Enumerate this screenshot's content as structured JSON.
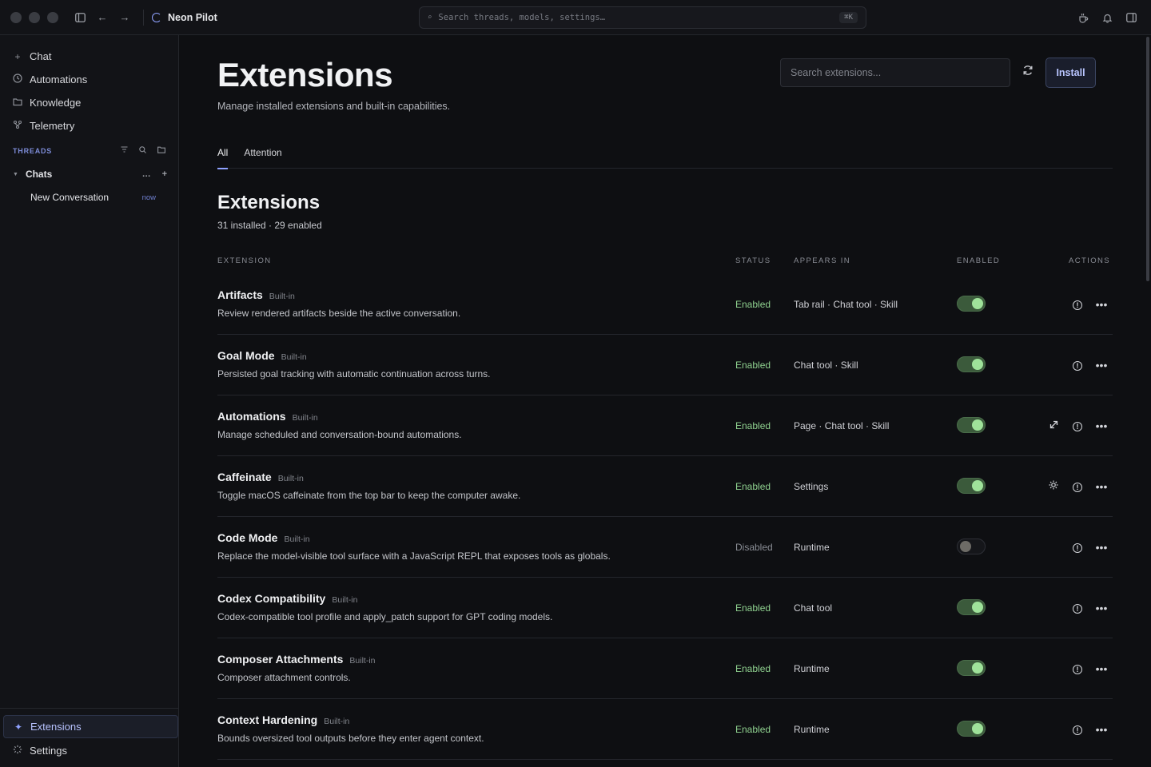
{
  "app": {
    "title": "Neon Pilot",
    "search_placeholder": "Search threads, models, settings…",
    "search_shortcut": "⌘K"
  },
  "sidebar": {
    "nav": [
      {
        "label": "Chat",
        "icon": "plus-icon"
      },
      {
        "label": "Automations",
        "icon": "clock-icon"
      },
      {
        "label": "Knowledge",
        "icon": "folder-icon"
      },
      {
        "label": "Telemetry",
        "icon": "telemetry-icon"
      }
    ],
    "threads_header": "THREADS",
    "group": {
      "label": "Chats"
    },
    "threads": [
      {
        "title": "New Conversation",
        "time": "now"
      }
    ],
    "bottom": [
      {
        "label": "Extensions",
        "icon": "sparkle-icon",
        "active": true
      },
      {
        "label": "Settings",
        "icon": "settings-icon",
        "active": false
      }
    ]
  },
  "page": {
    "title": "Extensions",
    "subtitle": "Manage installed extensions and built-in capabilities.",
    "search_placeholder": "Search extensions...",
    "install_label": "Install",
    "tabs": [
      {
        "label": "All",
        "active": true
      },
      {
        "label": "Attention",
        "active": false
      }
    ],
    "section_title": "Extensions",
    "section_summary": "31 installed · 29 enabled",
    "columns": {
      "extension": "EXTENSION",
      "status": "STATUS",
      "appears_in": "APPEARS IN",
      "enabled": "ENABLED",
      "actions": "ACTIONS"
    },
    "extensions": [
      {
        "name": "Artifacts",
        "badge": "Built-in",
        "description": "Review rendered artifacts beside the active conversation.",
        "status": "Enabled",
        "appears_in": "Tab rail · Chat tool · Skill",
        "enabled": true,
        "extra_action": ""
      },
      {
        "name": "Goal Mode",
        "badge": "Built-in",
        "description": "Persisted goal tracking with automatic continuation across turns.",
        "status": "Enabled",
        "appears_in": "Chat tool · Skill",
        "enabled": true,
        "extra_action": ""
      },
      {
        "name": "Automations",
        "badge": "Built-in",
        "description": "Manage scheduled and conversation-bound automations.",
        "status": "Enabled",
        "appears_in": "Page · Chat tool · Skill",
        "enabled": true,
        "extra_action": "open-external-icon"
      },
      {
        "name": "Caffeinate",
        "badge": "Built-in",
        "description": "Toggle macOS caffeinate from the top bar to keep the computer awake.",
        "status": "Enabled",
        "appears_in": "Settings",
        "enabled": true,
        "extra_action": "gear-icon"
      },
      {
        "name": "Code Mode",
        "badge": "Built-in",
        "description": "Replace the model-visible tool surface with a JavaScript REPL that exposes tools as globals.",
        "status": "Disabled",
        "appears_in": "Runtime",
        "enabled": false,
        "extra_action": ""
      },
      {
        "name": "Codex Compatibility",
        "badge": "Built-in",
        "description": "Codex-compatible tool profile and apply_patch support for GPT coding models.",
        "status": "Enabled",
        "appears_in": "Chat tool",
        "enabled": true,
        "extra_action": ""
      },
      {
        "name": "Composer Attachments",
        "badge": "Built-in",
        "description": "Composer attachment controls.",
        "status": "Enabled",
        "appears_in": "Runtime",
        "enabled": true,
        "extra_action": ""
      },
      {
        "name": "Context Hardening",
        "badge": "Built-in",
        "description": "Bounds oversized tool outputs before they enter agent context.",
        "status": "Enabled",
        "appears_in": "Runtime",
        "enabled": true,
        "extra_action": ""
      }
    ]
  },
  "colors": {
    "accent": "#8fa2ff",
    "enabled_green": "#8fd18f",
    "toggle_on": "#3b5a3b",
    "background": "#0e0f12"
  }
}
